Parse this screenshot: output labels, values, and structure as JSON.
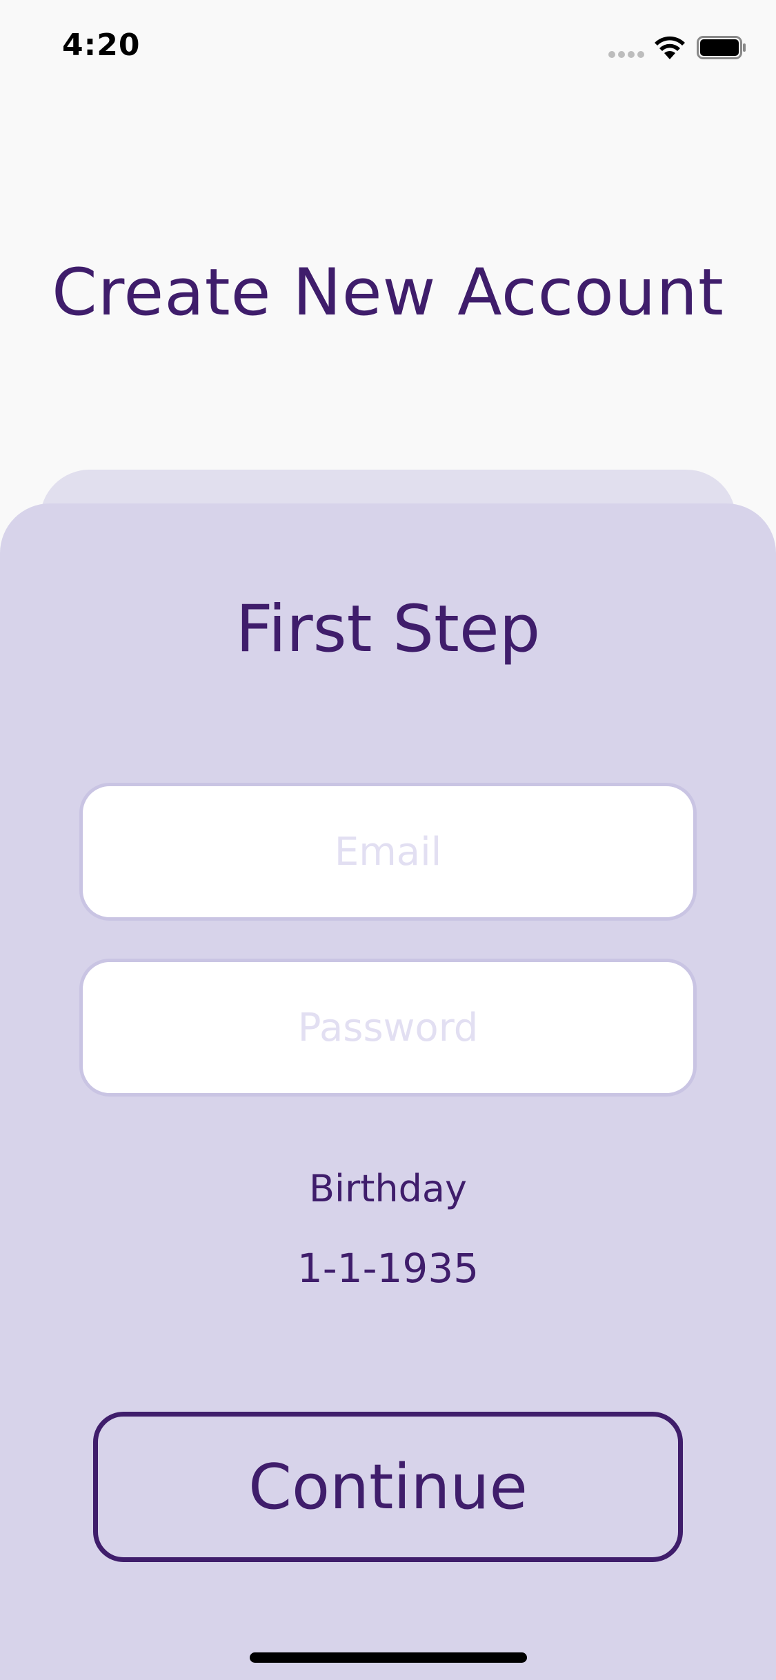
{
  "status_bar": {
    "time": "4:20"
  },
  "header": {
    "title": "Create New Account"
  },
  "form": {
    "step_title": "First Step",
    "email": {
      "placeholder": "Email",
      "value": ""
    },
    "password": {
      "placeholder": "Password",
      "value": ""
    },
    "birthday": {
      "label": "Birthday",
      "value": "1-1-1935"
    },
    "continue_label": "Continue"
  },
  "colors": {
    "background": "#F9F9F9",
    "card": "#D7D3EA",
    "back_card": "#E1DFEE",
    "accent": "#3F1D6B",
    "input_border": "#C9C4E3",
    "placeholder": "#E2DFF2"
  },
  "icons": {
    "signal": "cellular-signal-icon",
    "wifi": "wifi-icon",
    "battery": "battery-icon"
  }
}
